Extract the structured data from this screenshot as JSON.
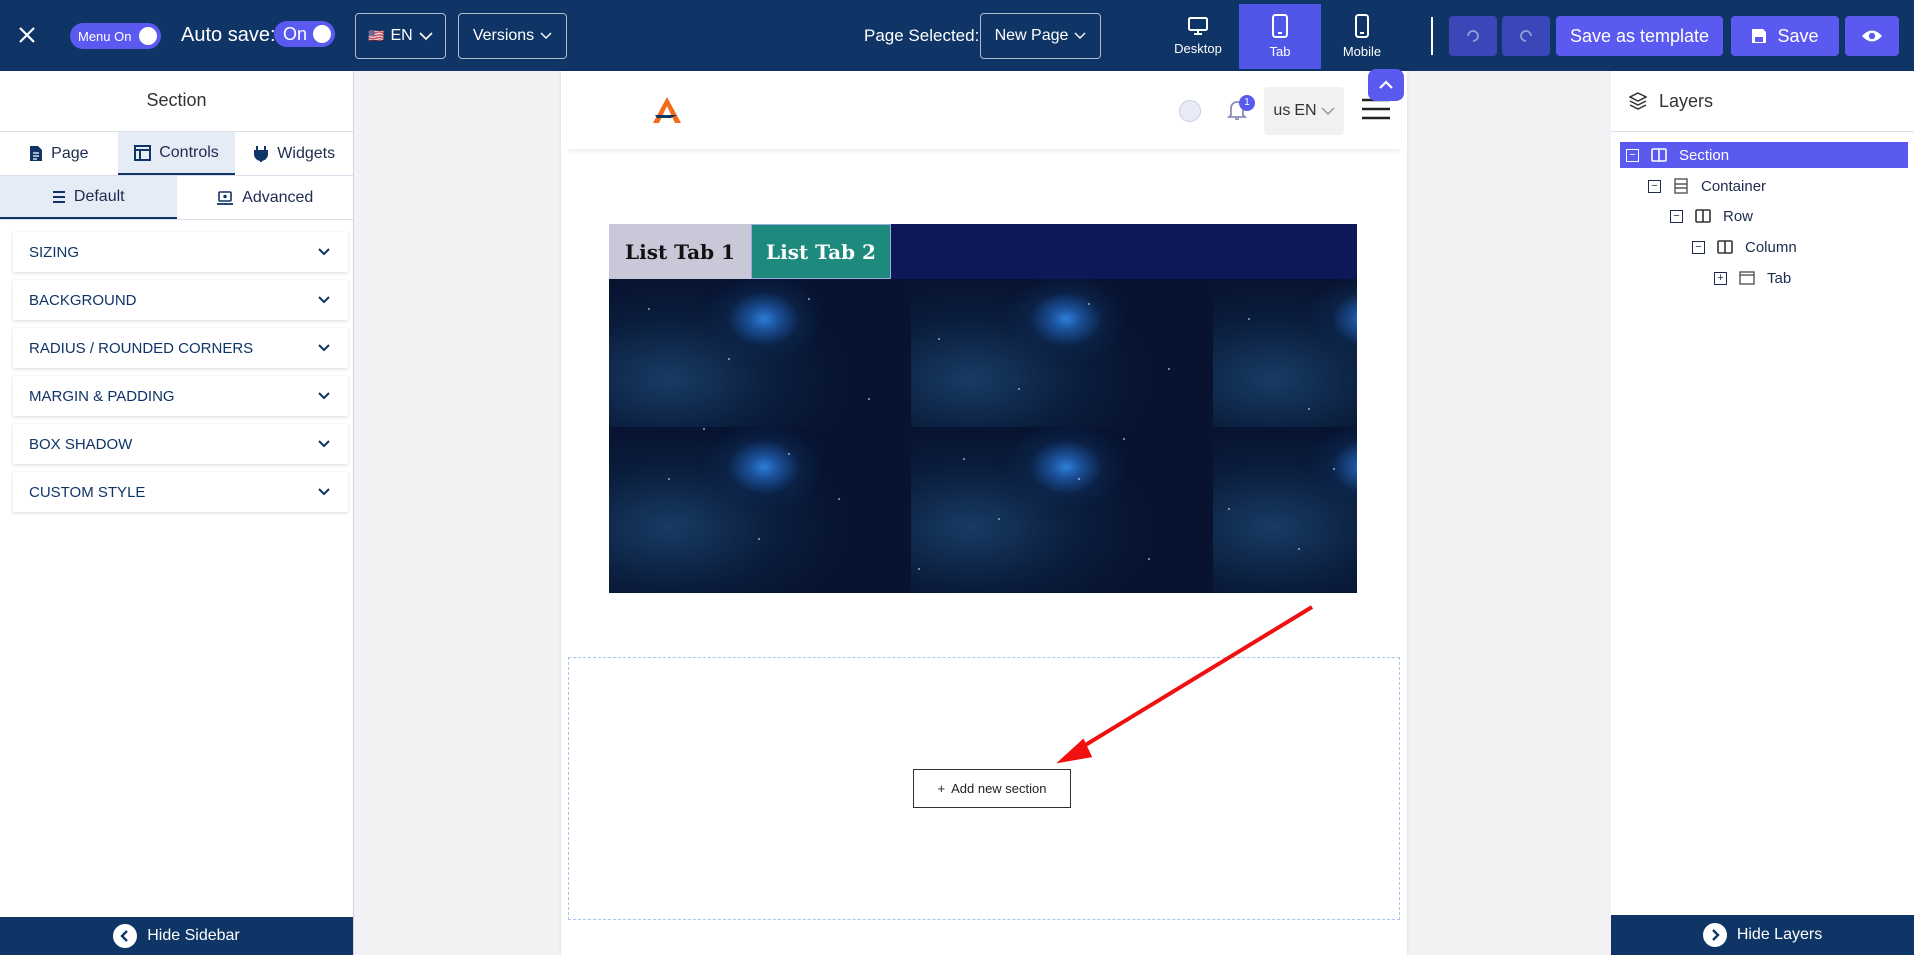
{
  "topbar": {
    "menu_toggle": "Menu On",
    "autosave_label": "Auto save:",
    "autosave_value": "On",
    "language": "EN",
    "language_flag": "🇺🇸",
    "versions": "Versions",
    "page_selected_label": "Page Selected:",
    "page_selected_value": "New Page",
    "devices": [
      "Desktop",
      "Tab",
      "Mobile"
    ],
    "active_device": "Tab",
    "save_template": "Save as template",
    "save": "Save"
  },
  "sidebar": {
    "title": "Section",
    "tabs": [
      "Page",
      "Controls",
      "Widgets"
    ],
    "active_tab": "Controls",
    "subtabs": [
      "Default",
      "Advanced"
    ],
    "active_subtab": "Default",
    "sections": [
      "SIZING",
      "BACKGROUND",
      "RADIUS / ROUNDED CORNERS",
      "MARGIN & PADDING",
      "BOX SHADOW",
      "CUSTOM STYLE"
    ],
    "hide_label": "Hide Sidebar"
  },
  "canvas": {
    "notification_count": "1",
    "lang_code": "us",
    "lang": "EN",
    "tab1": "List Tab 1",
    "tab2": "List Tab 2",
    "add_section": "Add new section"
  },
  "layers": {
    "title": "Layers",
    "items": [
      "Section",
      "Container",
      "Row",
      "Column",
      "Tab"
    ],
    "selected": "Section",
    "hide_label": "Hide Layers"
  },
  "colors": {
    "topbar": "#0f3466",
    "accent": "#5a5af0",
    "tab1_bg": "#c9c8d9",
    "tab2_bg": "#1d8a7d",
    "tab_strip": "#0d1858"
  }
}
